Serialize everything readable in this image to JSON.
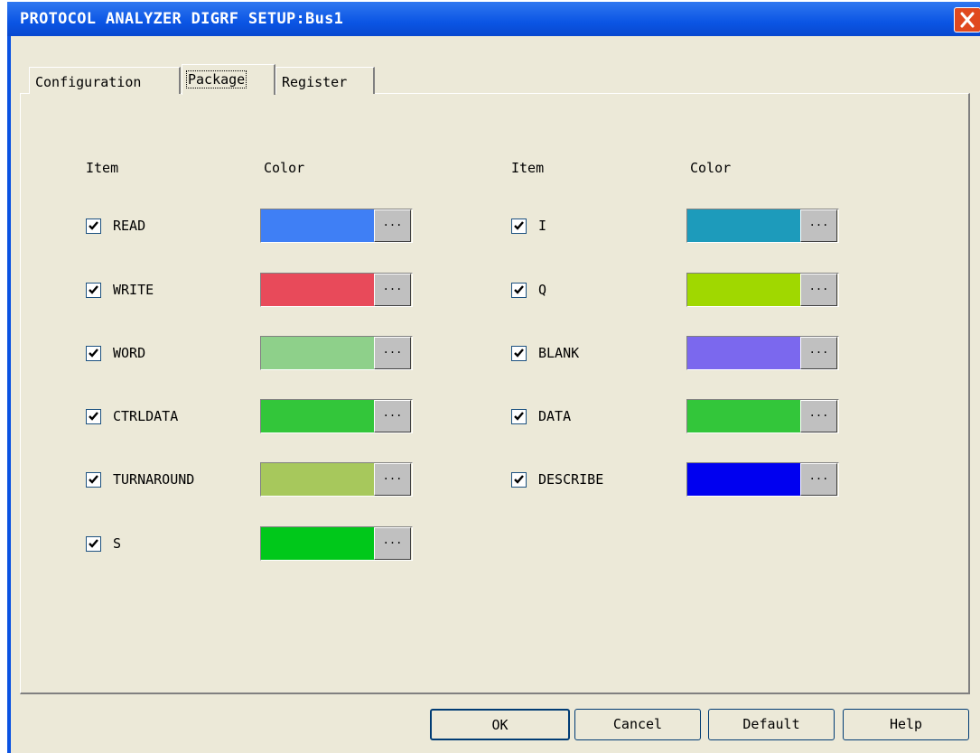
{
  "window": {
    "title": "PROTOCOL ANALYZER DIGRF SETUP:Bus1"
  },
  "tabs": [
    {
      "label": "Configuration"
    },
    {
      "label": "Package",
      "active": true
    },
    {
      "label": "Register"
    }
  ],
  "columns": {
    "item_header": "Item",
    "color_header": "Color"
  },
  "left_items": [
    {
      "label": "READ",
      "checked": true,
      "color": "#3f7ff5"
    },
    {
      "label": "WRITE",
      "checked": true,
      "color": "#e84a5a"
    },
    {
      "label": "WORD",
      "checked": true,
      "color": "#8ed08a"
    },
    {
      "label": "CTRLDATA",
      "checked": true,
      "color": "#33c63a"
    },
    {
      "label": "TURNAROUND",
      "checked": true,
      "color": "#a7c85c"
    },
    {
      "label": "S",
      "checked": true,
      "color": "#00c81a"
    }
  ],
  "right_items": [
    {
      "label": "I",
      "checked": true,
      "color": "#1d9bbb"
    },
    {
      "label": "Q",
      "checked": true,
      "color": "#a0d800"
    },
    {
      "label": "BLANK",
      "checked": true,
      "color": "#7b68ee"
    },
    {
      "label": "DATA",
      "checked": true,
      "color": "#33c63a"
    },
    {
      "label": "DESCRIBE",
      "checked": true,
      "color": "#0000f0"
    }
  ],
  "color_button_label": "...",
  "buttons": {
    "ok": "OK",
    "cancel": "Cancel",
    "default": "Default",
    "help": "Help"
  }
}
